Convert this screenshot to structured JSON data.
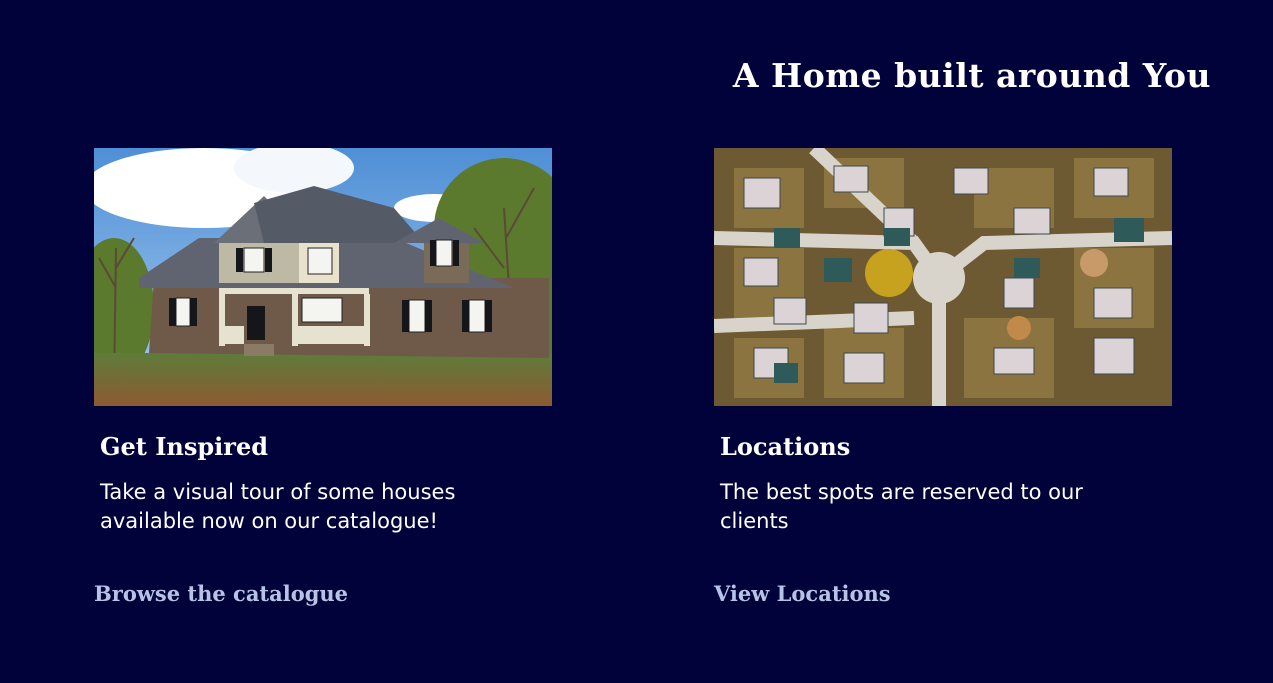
{
  "hero": {
    "title": "A Home built around You"
  },
  "cards": [
    {
      "image": "house-photo",
      "title": "Get Inspired",
      "text": "Take a visual tour of some houses available now on our catalogue!",
      "link_label": "Browse the catalogue"
    },
    {
      "image": "aerial-neighborhood-photo",
      "title": "Locations",
      "text": "The best spots are reserved to our clients",
      "link_label": "View Locations"
    }
  ],
  "colors": {
    "background": "#02023a",
    "text": "#ffffff",
    "link": "#b7c3e6"
  }
}
